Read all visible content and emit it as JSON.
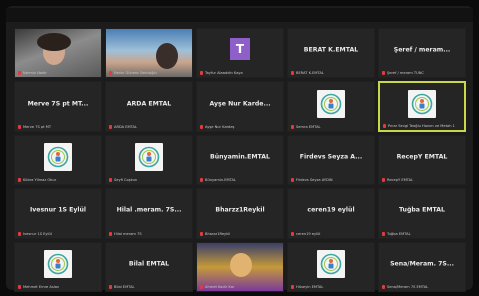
{
  "tiles": [
    {
      "id": "t1",
      "kind": "video1",
      "name": "",
      "foot": "Nermin Nadir",
      "active": false
    },
    {
      "id": "t2",
      "kind": "video2",
      "name": "",
      "foot": "Nevin Günenc Belcioğlu",
      "active": false
    },
    {
      "id": "t3",
      "kind": "avatar",
      "avatar": "T",
      "name": "",
      "foot": "Tayfur Alaaddin Kaya",
      "active": false
    },
    {
      "id": "t4",
      "kind": "name",
      "name": "BERAT K.EMTAL",
      "foot": "BERAT K.EMTAL",
      "active": false
    },
    {
      "id": "t5",
      "kind": "name",
      "name": "Şeref / meram...",
      "foot": "Şeref / meram TUNC",
      "active": false
    },
    {
      "id": "t6",
      "kind": "name",
      "name": "Merve 7S pt MT...",
      "foot": "Merve 7S pt MT",
      "active": false
    },
    {
      "id": "t7",
      "kind": "name",
      "name": "ARDA EMTAL",
      "foot": "ARDA EMTAL",
      "active": false
    },
    {
      "id": "t8",
      "kind": "name",
      "name": "Ayşe Nur Karde...",
      "foot": "Ayşe Nur Kardeş",
      "active": false
    },
    {
      "id": "t9",
      "kind": "logo",
      "name": "",
      "foot": "Semra EMTAL",
      "active": false
    },
    {
      "id": "t10",
      "kind": "logo",
      "name": "",
      "foot": "Pınar Sevgi Teoğlu Hanım ve Metah 1",
      "active": true
    },
    {
      "id": "t11",
      "kind": "logo",
      "name": "",
      "foot": "Kübra Yilmaz Obur",
      "active": false
    },
    {
      "id": "t12",
      "kind": "logo",
      "name": "",
      "foot": "Seyfi Coşkun",
      "active": false
    },
    {
      "id": "t13",
      "kind": "name",
      "name": "Bünyamin.EMTAL",
      "foot": "Bünyamin.EMTAL",
      "active": false
    },
    {
      "id": "t14",
      "kind": "name",
      "name": "Firdevs Seyza A...",
      "foot": "Firdevs Seyza AYDIN",
      "active": false
    },
    {
      "id": "t15",
      "kind": "name",
      "name": "RecepY EMTAL",
      "foot": "RecepY EMTAL",
      "active": false
    },
    {
      "id": "t16",
      "kind": "name",
      "name": "İvesnur 1S Eylül",
      "foot": "İvesnur 1S Eylül",
      "active": false
    },
    {
      "id": "t17",
      "kind": "name",
      "name": "Hilal .meram. 7S...",
      "foot": "Hilal meram 7S",
      "active": false
    },
    {
      "id": "t18",
      "kind": "name",
      "name": "Bharzz1Reykil",
      "foot": "Bharzz1Reykil",
      "active": false
    },
    {
      "id": "t19",
      "kind": "name",
      "name": "ceren19 eylül",
      "foot": "ceren19 eylül",
      "active": false
    },
    {
      "id": "t20",
      "kind": "name",
      "name": "Tuğba EMTAL",
      "foot": "Tuğba EMTAL",
      "active": false
    },
    {
      "id": "t21",
      "kind": "logo",
      "name": "",
      "foot": "Mehmet Emre Aslan",
      "active": false
    },
    {
      "id": "t22",
      "kind": "name",
      "name": "Bilal EMTAL",
      "foot": "Bilal EMTAL",
      "active": false
    },
    {
      "id": "t23",
      "kind": "video3",
      "name": "",
      "foot": "Ahmet Kadir Kar",
      "active": false
    },
    {
      "id": "t24",
      "kind": "logo",
      "name": "",
      "foot": "Hüseyin EMTAL",
      "active": false
    },
    {
      "id": "t25",
      "kind": "name",
      "name": "Sena/Meram. 7S...",
      "foot": "Sena/Meram 7S EMTAL",
      "active": false
    }
  ]
}
